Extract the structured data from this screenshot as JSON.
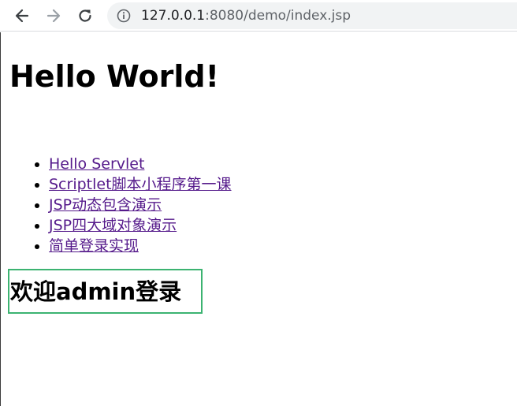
{
  "browser": {
    "back_icon": "arrow-left-icon",
    "forward_icon": "arrow-right-icon",
    "reload_icon": "reload-icon",
    "info_icon": "info-icon",
    "url_host": "127.0.0.1",
    "url_rest": ":8080/demo/index.jsp"
  },
  "page": {
    "title": "Hello World!",
    "links": [
      {
        "label": "Hello Servlet"
      },
      {
        "label": "Scriptlet脚本小程序第一课"
      },
      {
        "label": "JSP动态包含演示"
      },
      {
        "label": "JSP四大域对象演示"
      },
      {
        "label": "简单登录实现"
      }
    ],
    "welcome": "欢迎admin登录"
  },
  "colors": {
    "link_visited": "#551a8b",
    "welcome_border": "#3cb371"
  }
}
